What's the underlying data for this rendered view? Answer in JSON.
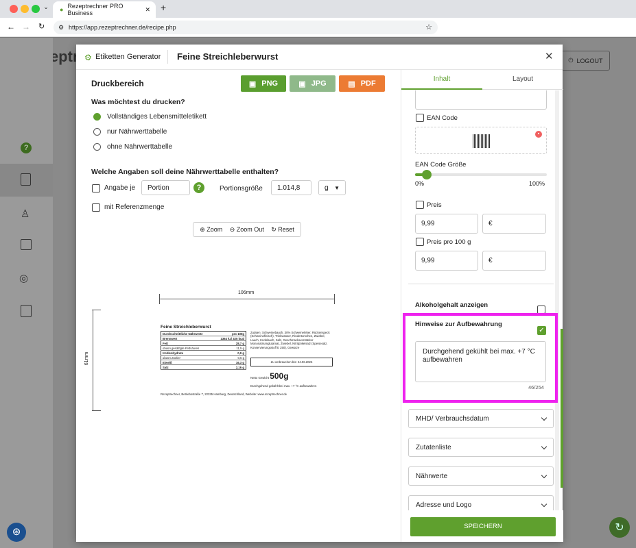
{
  "browser": {
    "tab_title": "Rezeptrechner PRO Business",
    "url": "https://app.rezeptrechner.de/recipe.php"
  },
  "bg": {
    "logo": "Rezeptre",
    "logout": "LOGOUT"
  },
  "modal": {
    "generator_label": "Etiketten Generator",
    "title": "Feine Streichleberwurst"
  },
  "left": {
    "print_area": "Druckbereich",
    "png": "PNG",
    "jpg": "JPG",
    "pdf": "PDF",
    "question1": "Was möchtest du drucken?",
    "options": [
      "Vollständiges Lebensmitteletikett",
      "nur Nährwerttabelle",
      "ohne Nährwerttabelle"
    ],
    "question2": "Welche Angaben soll deine Nährwerttabelle enthalten?",
    "angabe_je": "Angabe je",
    "portion_value": "Portion",
    "portion_size_label": "Portionsgröße",
    "portion_size_value": "1.014,8",
    "unit": "g",
    "referenzmenge": "mit Referenzmenge",
    "zoom_in": "Zoom",
    "zoom_out": "Zoom Out",
    "reset": "Reset",
    "width_dim": "106mm",
    "height_dim": "61mm"
  },
  "label": {
    "title": "Feine Streichleberwurst",
    "header_left": "Durchschnittliche Nährwerte",
    "header_right": "pro 100g",
    "rows": [
      {
        "name": "Brennwert",
        "value": "1364 kJ/ 325 kcal"
      },
      {
        "name": "Fett",
        "value": "28,7 g"
      },
      {
        "name": "davon gesättigte Fettsäuren",
        "value": "11,5 g"
      },
      {
        "name": "Kohlenhydrate",
        "value": "0,9 g"
      },
      {
        "name": "davon Zucker",
        "value": "0,6 g"
      },
      {
        "name": "Eiweiß",
        "value": "16,3 g"
      },
      {
        "name": "Salz",
        "value": "2,16 g"
      }
    ],
    "ingredients": "Zutaten: Schweinebauch, 30% Schweineleber, Rückenspeck (Schweinefleisch), Trinkwasser, Rindertorschen, Zwiebel, Lauch, Knoblauch, Salz, Geschmacksverstärker Mononatriumglutamat, Zwiebel, Nitritpökelsalz (Speisesalz, Konservierungsstoff E 250), Gewürze",
    "mhd": "Zu verbrauchen bis: 24.06.2026",
    "net_label": "Netto Gewicht",
    "net_value": "500g",
    "storage": "Durchgehend gekühlt bei max. +7 °C aufbewahren",
    "address": "Rezeptrechner, Betriebsstraße 7, 22335 Hamburg, Deutschland, Website: www.rezeptrechner.de"
  },
  "right": {
    "tab_content": "Inhalt",
    "tab_layout": "Layout",
    "ean_code": "EAN Code",
    "ean_size": "EAN Code Größe",
    "slider_min": "0%",
    "slider_max": "100%",
    "ean_size_value": 0.09,
    "preis": "Preis",
    "preis_value": "9,99",
    "currency": "€",
    "preis100": "Preis pro 100 g",
    "preis100_value": "9,99",
    "currency2": "€",
    "alcohol": "Alkoholgehalt anzeigen",
    "storage_title": "Hinweise zur Aufbewahrung",
    "storage_text": "Durchgehend gekühlt bei max. +7 °C aufbewahren",
    "counter": "46/254",
    "sections": [
      "MHD/ Verbrauchsdatum",
      "Zutatenliste",
      "Nährwerte",
      "Adresse und Logo"
    ],
    "save": "SPEICHERN"
  },
  "colors": {
    "green": "#5fa02e",
    "png": "#5a9e2f",
    "jpg": "#8fb98a",
    "pdf": "#ec7b33",
    "highlight": "#ee22ee"
  }
}
